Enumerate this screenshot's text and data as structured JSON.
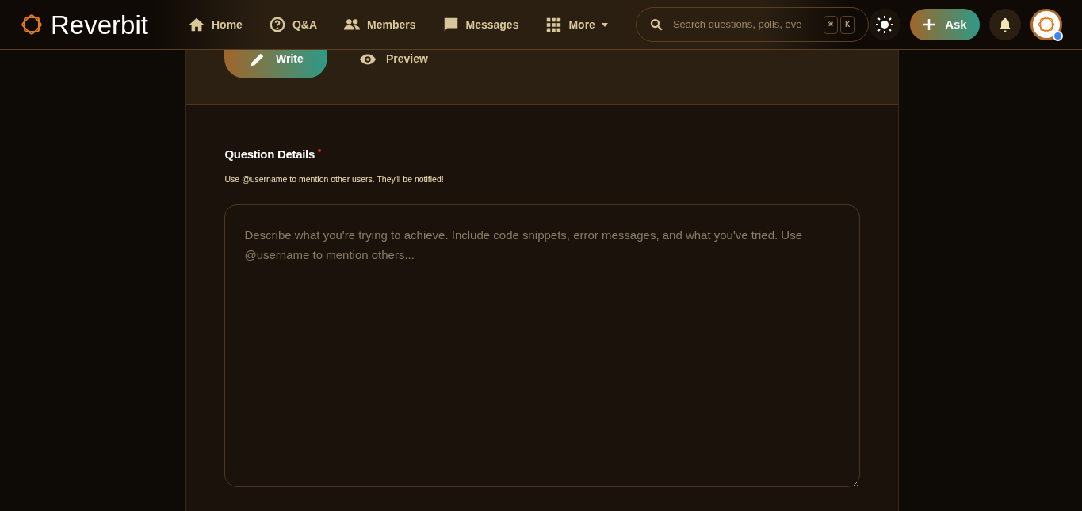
{
  "brand": "Reverbit",
  "nav": [
    {
      "label": "Home",
      "selected": false
    },
    {
      "label": "Q&A",
      "selected": false
    },
    {
      "label": "Members",
      "selected": false
    },
    {
      "label": "Messages",
      "selected": false
    },
    {
      "label": "More",
      "selected": false
    }
  ],
  "search": {
    "placeholder": "Search questions, polls, eve",
    "keys": [
      "⌘",
      "K"
    ]
  },
  "ask_button": "Ask",
  "editor_tabs": [
    {
      "label": "Write",
      "selected": true
    },
    {
      "label": "Preview",
      "selected": false
    }
  ],
  "field": {
    "label": "Question Details",
    "required": true,
    "hint": "Use @username to mention other users. They'll be notified!",
    "placeholder": "Describe what you're trying to achieve. Include code snippets, error messages, and what you've tried. Use @username to mention others..."
  }
}
